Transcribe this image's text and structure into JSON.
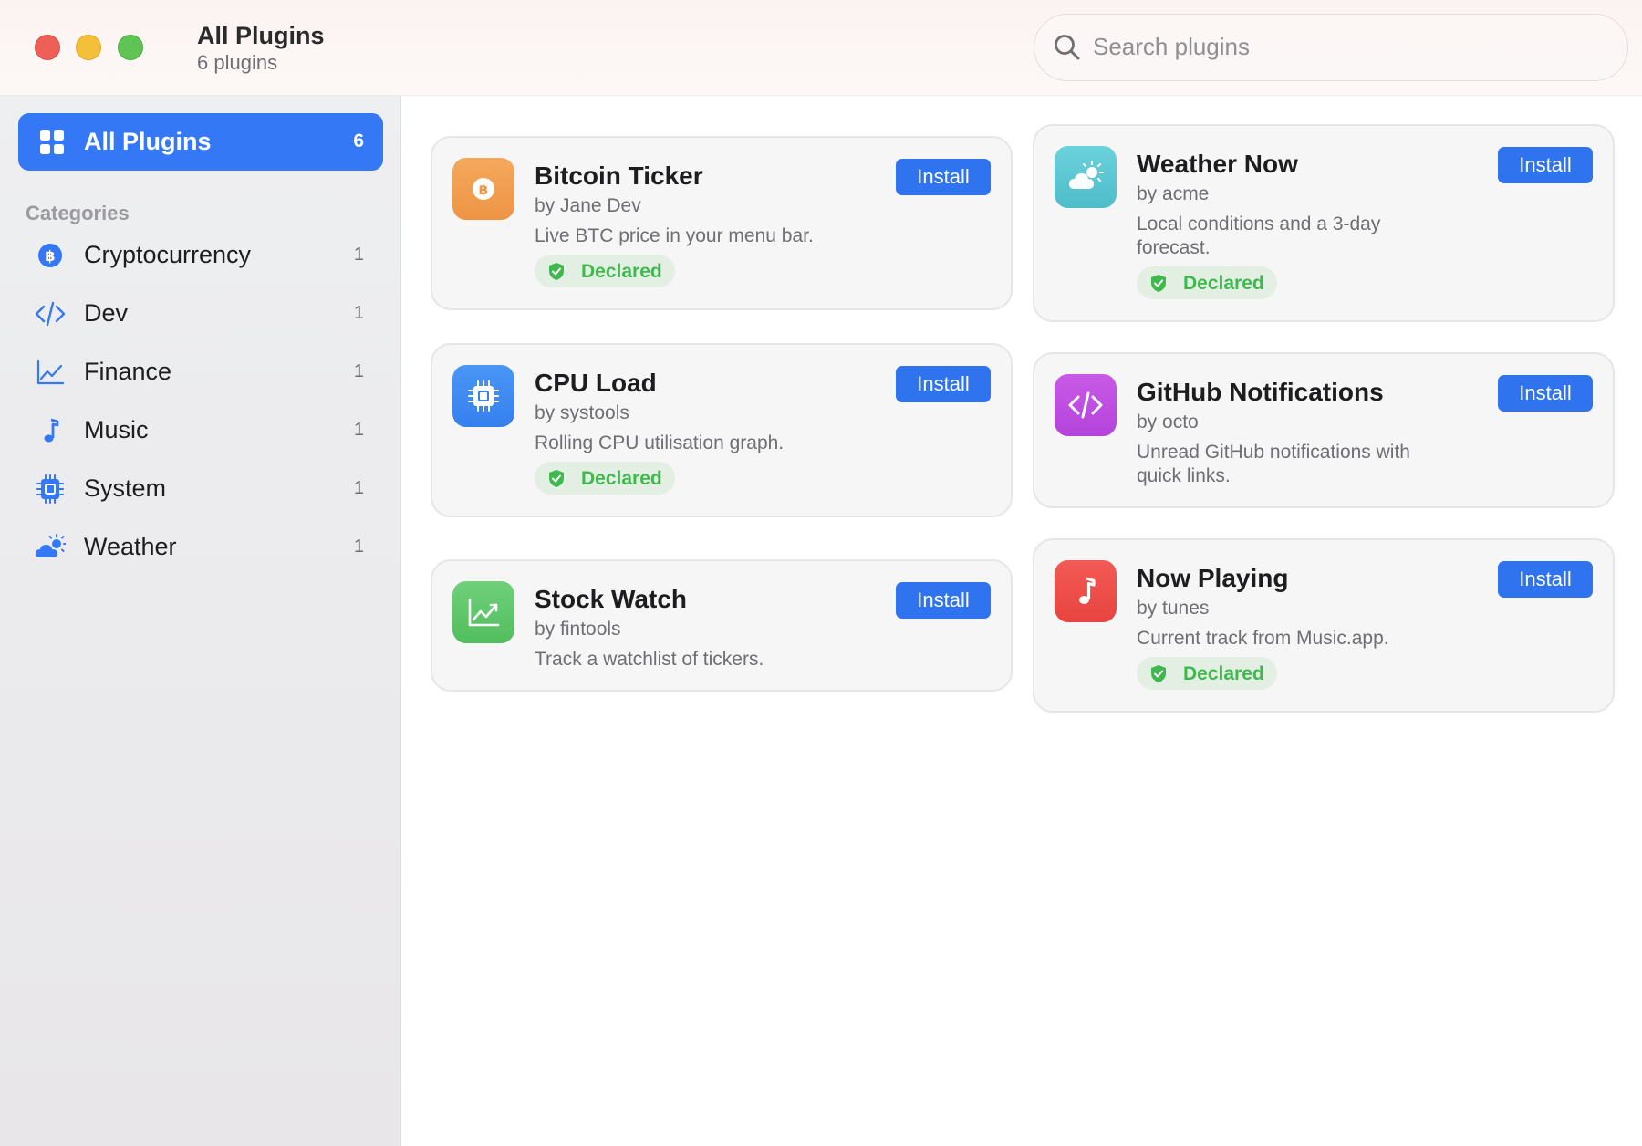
{
  "window": {
    "title": "All Plugins",
    "subtitle": "6 plugins"
  },
  "search": {
    "placeholder": "Search plugins",
    "value": ""
  },
  "sidebar": {
    "all": {
      "label": "All Plugins",
      "count": "6",
      "icon": "grid-icon"
    },
    "heading": "Categories",
    "items": [
      {
        "label": "Cryptocurrency",
        "count": "1",
        "icon": "bitcoin-icon"
      },
      {
        "label": "Dev",
        "count": "1",
        "icon": "code-icon"
      },
      {
        "label": "Finance",
        "count": "1",
        "icon": "chart-line-icon"
      },
      {
        "label": "Music",
        "count": "1",
        "icon": "music-note-icon"
      },
      {
        "label": "System",
        "count": "1",
        "icon": "cpu-icon"
      },
      {
        "label": "Weather",
        "count": "1",
        "icon": "cloud-sun-icon"
      }
    ]
  },
  "plugins": [
    {
      "name": "Bitcoin Ticker",
      "author": "by Jane Dev",
      "description": "Live BTC price in your menu bar.",
      "badge": "Declared",
      "install": "Install",
      "icon": "bitcoin-icon",
      "color": "#f0a050"
    },
    {
      "name": "Weather Now",
      "author": "by acme",
      "description": "Local conditions and a 3-day forecast.",
      "badge": "Declared",
      "install": "Install",
      "icon": "cloud-sun-icon",
      "color": "#5ec8d4"
    },
    {
      "name": "CPU Load",
      "author": "by systools",
      "description": "Rolling CPU utilisation graph.",
      "badge": "Declared",
      "install": "Install",
      "icon": "cpu-icon",
      "color": "#3f8cf2"
    },
    {
      "name": "GitHub Notifications",
      "author": "by octo",
      "description": "Unread GitHub notifications with quick links.",
      "install": "Install",
      "icon": "code-icon",
      "color": "#c04fe0"
    },
    {
      "name": "Stock Watch",
      "author": "by fintools",
      "description": "Track a watchlist of tickers.",
      "install": "Install",
      "icon": "chart-line-icon",
      "color": "#5cc767"
    },
    {
      "name": "Now Playing",
      "author": "by tunes",
      "description": "Current track from Music.app.",
      "badge": "Declared",
      "install": "Install",
      "icon": "music-note-icon",
      "color": "#ef4f4a"
    }
  ],
  "colors": {
    "accent": "#3478f6",
    "badge_green": "#40b84d"
  }
}
